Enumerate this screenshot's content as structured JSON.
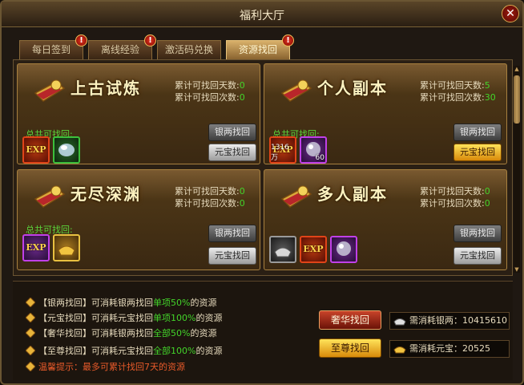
{
  "window": {
    "title": "福利大厅",
    "close_label": "✕"
  },
  "tabs": [
    {
      "label": "每日签到",
      "badge": "!"
    },
    {
      "label": "离线经验",
      "badge": "!"
    },
    {
      "label": "激活码兑换",
      "badge": ""
    },
    {
      "label": "资源找回",
      "badge": "!"
    }
  ],
  "cards": [
    {
      "title": "上古试炼",
      "days_label": "累计可找回天数:",
      "days_value": "0",
      "times_label": "累计可找回次数:",
      "times_value": "0",
      "total_label": "总共可找回:",
      "silver_btn": "银两找回",
      "gold_btn": "元宝找回",
      "items": [
        {
          "type": "exp",
          "label": "EXP",
          "count": ""
        },
        {
          "type": "orb",
          "label": "",
          "count": ""
        }
      ]
    },
    {
      "title": "个人副本",
      "days_label": "累计可找回天数:",
      "days_value": "5",
      "times_label": "累计可找回次数:",
      "times_value": "30",
      "total_label": "总共可找回:",
      "silver_btn": "银两找回",
      "gold_btn": "元宝找回",
      "items": [
        {
          "type": "exp",
          "label": "EXP",
          "count": "1316万"
        },
        {
          "type": "orb",
          "label": "",
          "count": "60"
        }
      ]
    },
    {
      "title": "无尽深渊",
      "days_label": "累计可找回天数:",
      "days_value": "0",
      "times_label": "累计可找回次数:",
      "times_value": "0",
      "total_label": "总共可找回:",
      "silver_btn": "银两找回",
      "gold_btn": "元宝找回",
      "items": [
        {
          "type": "exp",
          "label": "EXP",
          "count": ""
        },
        {
          "type": "gold",
          "label": "",
          "count": ""
        }
      ]
    },
    {
      "title": "多人副本",
      "days_label": "累计可找回天数:",
      "days_value": "0",
      "times_label": "累计可找回次数:",
      "times_value": "0",
      "total_label": "",
      "silver_btn": "银两找回",
      "gold_btn": "元宝找回",
      "items": [
        {
          "type": "silver",
          "label": "",
          "count": ""
        },
        {
          "type": "exp",
          "label": "EXP",
          "count": ""
        },
        {
          "type": "orb",
          "label": "",
          "count": ""
        }
      ]
    }
  ],
  "info": [
    {
      "prefix": "【银两找回】可消耗银两找回",
      "highlight": "单项50%",
      "suffix": "的资源"
    },
    {
      "prefix": "【元宝找回】可消耗元宝找回",
      "highlight": "单项100%",
      "suffix": "的资源"
    },
    {
      "prefix": "【奢华找回】可消耗银两找回",
      "highlight": "全部50%",
      "suffix": "的资源"
    },
    {
      "prefix": "【至尊找回】可消耗元宝找回",
      "highlight": "全部100%",
      "suffix": "的资源"
    }
  ],
  "tip": "温馨提示：最多可累计找回7天的资源",
  "luxury_btn": "奢华找回",
  "supreme_btn": "至尊找回",
  "silver_cost": "需消耗银两：10415610",
  "gold_cost": "需消耗元宝：20525",
  "colors": {
    "accent_gold": "#d8a848",
    "value_green": "#43d42a",
    "warn_red": "#e85a2a"
  }
}
